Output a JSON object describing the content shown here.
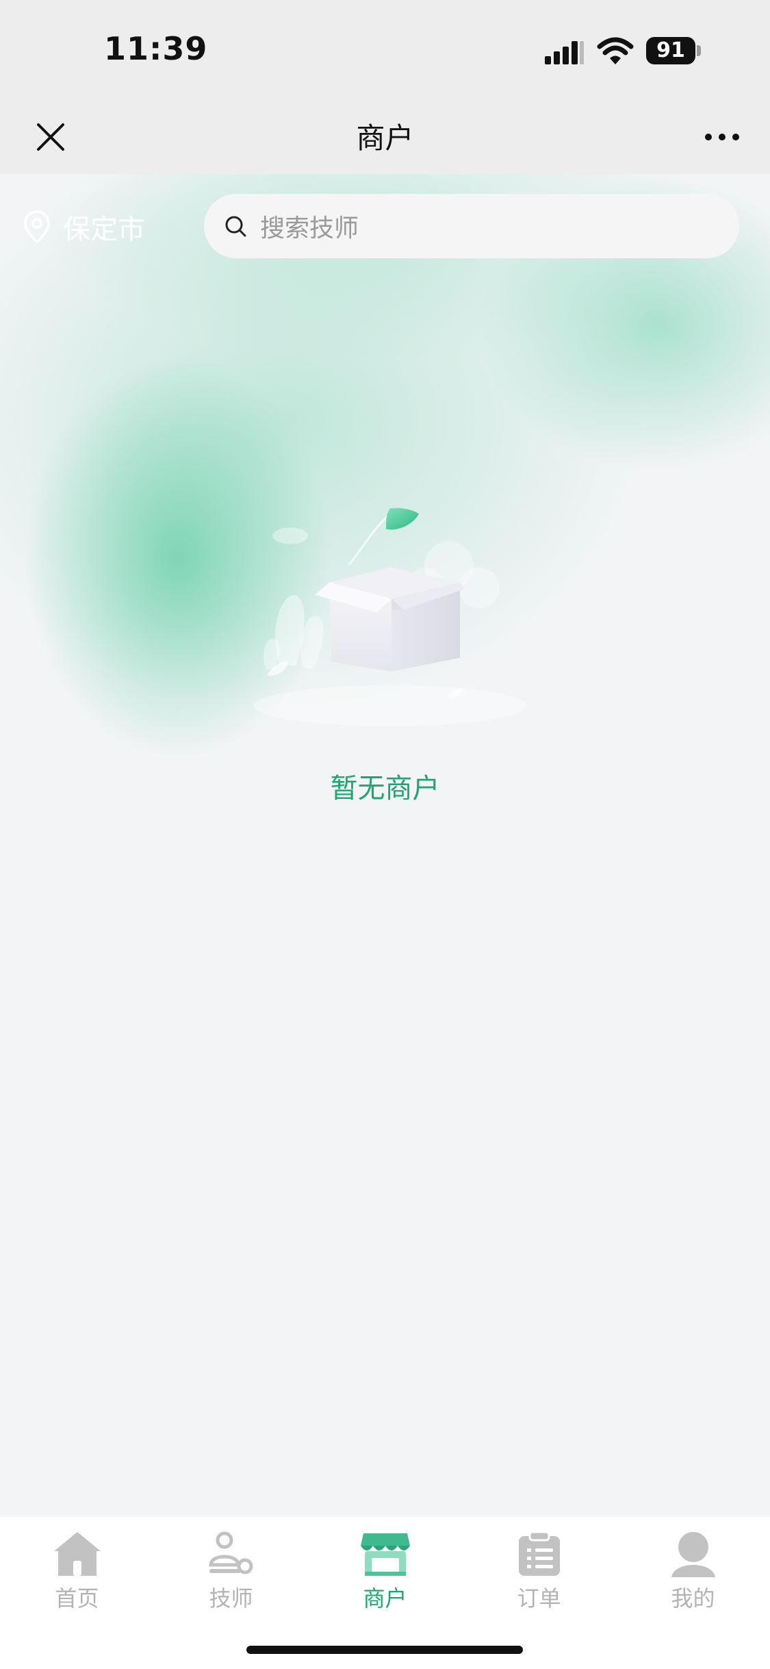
{
  "status_bar": {
    "time": "11:39",
    "battery": "91"
  },
  "nav": {
    "title": "商户",
    "close_icon": "close-icon",
    "more_icon": "more-icon"
  },
  "location": {
    "city": "保定市",
    "icon": "location-pin-icon"
  },
  "search": {
    "placeholder": "搜索技师",
    "icon": "search-icon"
  },
  "empty_state": {
    "message": "暂无商户",
    "illustration": "empty-box-illustration"
  },
  "tab_bar": {
    "tabs": [
      {
        "label": "首页",
        "icon": "home-icon",
        "active": false
      },
      {
        "label": "技师",
        "icon": "technician-icon",
        "active": false
      },
      {
        "label": "商户",
        "icon": "shop-icon",
        "active": true
      },
      {
        "label": "订单",
        "icon": "orders-icon",
        "active": false
      },
      {
        "label": "我的",
        "icon": "profile-icon",
        "active": false
      }
    ]
  },
  "colors": {
    "accent": "#1aa86f",
    "inactive": "#b3b3b3",
    "background": "#f3f4f6",
    "glow": "#60cda5"
  }
}
